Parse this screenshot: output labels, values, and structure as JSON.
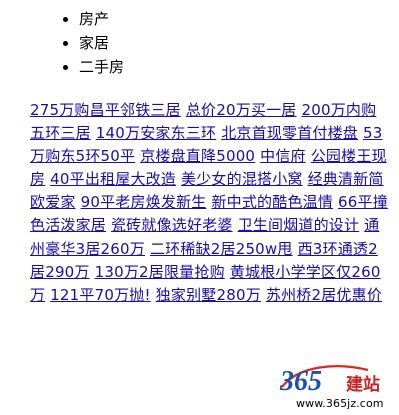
{
  "nav": {
    "items": [
      "房产",
      "家居",
      "二手房"
    ]
  },
  "links": [
    "275万购昌平邻铁三居",
    "总价20万买一居",
    "200万内购五环三居",
    "140万安家东三环",
    "北京首现零首付楼盘",
    "53万购东5环50平",
    "京楼盘直降5000",
    "中信府",
    "公园楼王现房",
    "40平出租屋大改造",
    "美少女的混搭小窝",
    "经典清新简欧爱家",
    "90平老房焕发新生",
    "新中式的酷色温情",
    "66平撞色活泼家居",
    "瓷砖就像选好老婆",
    "卫生间烟道的设计",
    "通州豪华3居260万",
    "二环稀缺2居250w甩",
    "西3环通透2居290万",
    "130万2居限量抢购",
    "黄城根小学学区仅260万",
    "121平70万抛!",
    "独家别墅280万",
    "苏州桥2居优惠价"
  ],
  "watermark": {
    "logo_text": "365",
    "brand_text": "建站",
    "url": "www.365jz.com",
    "colors": {
      "logo_blue": "#1f4fa8",
      "logo_red": "#d92b1f",
      "brand_red": "#cc2222"
    }
  }
}
